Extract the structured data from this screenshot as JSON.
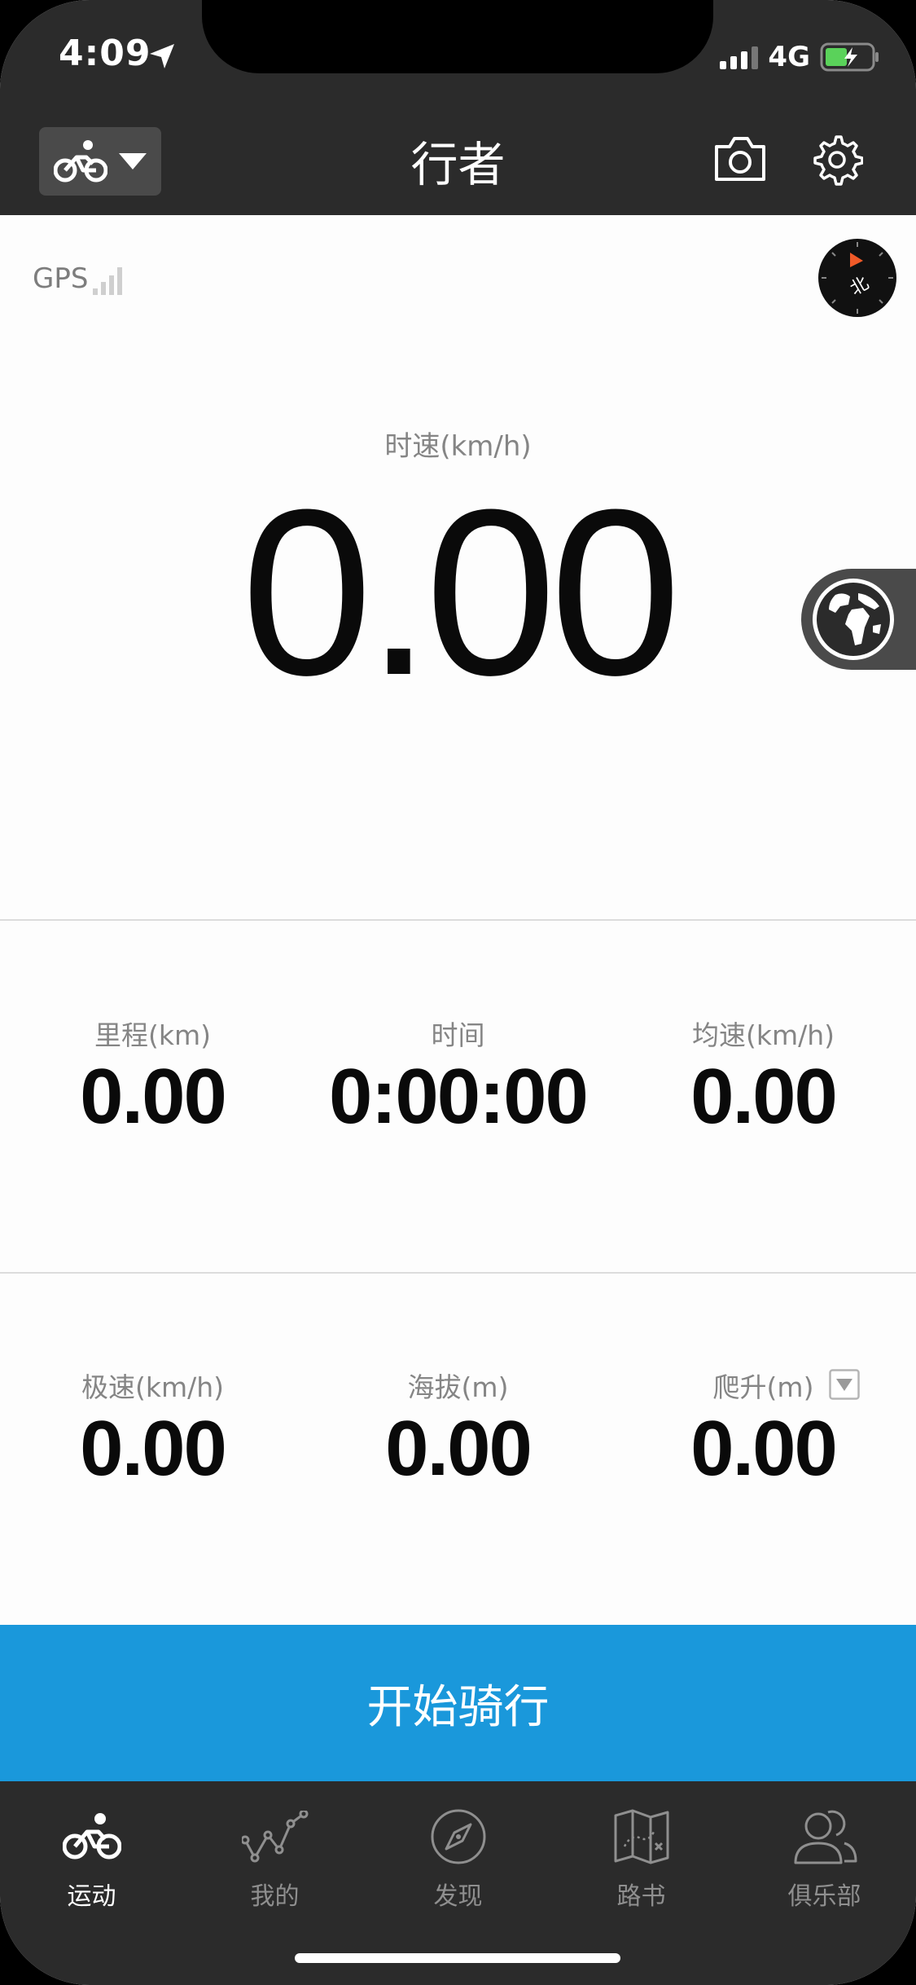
{
  "status_bar": {
    "time": "4:09",
    "network": "4G"
  },
  "nav": {
    "title": "行者",
    "mode_icon": "bike-icon",
    "camera_icon": "camera-icon",
    "settings_icon": "gear-icon"
  },
  "gps": {
    "label": "GPS"
  },
  "compass": {
    "label": "北"
  },
  "speed": {
    "label": "时速(km/h)",
    "value": "0.00"
  },
  "stats_row1": [
    {
      "label": "里程(km)",
      "value": "0.00"
    },
    {
      "label": "时间",
      "value": "0:00:00"
    },
    {
      "label": "均速(km/h)",
      "value": "0.00"
    }
  ],
  "stats_row2": [
    {
      "label": "极速(km/h)",
      "value": "0.00"
    },
    {
      "label": "海拔(m)",
      "value": "0.00"
    },
    {
      "label": "爬升(m)",
      "value": "0.00"
    }
  ],
  "start_button": {
    "label": "开始骑行"
  },
  "tabs": [
    {
      "label": "运动",
      "icon": "bike-icon",
      "active": true
    },
    {
      "label": "我的",
      "icon": "trend-icon",
      "active": false
    },
    {
      "label": "发现",
      "icon": "compass-icon",
      "active": false
    },
    {
      "label": "路书",
      "icon": "map-icon",
      "active": false
    },
    {
      "label": "俱乐部",
      "icon": "people-icon",
      "active": false
    }
  ],
  "colors": {
    "accent": "#1a98db",
    "bar_dark": "#2b2b2b",
    "battery_green": "#5ad25a"
  }
}
